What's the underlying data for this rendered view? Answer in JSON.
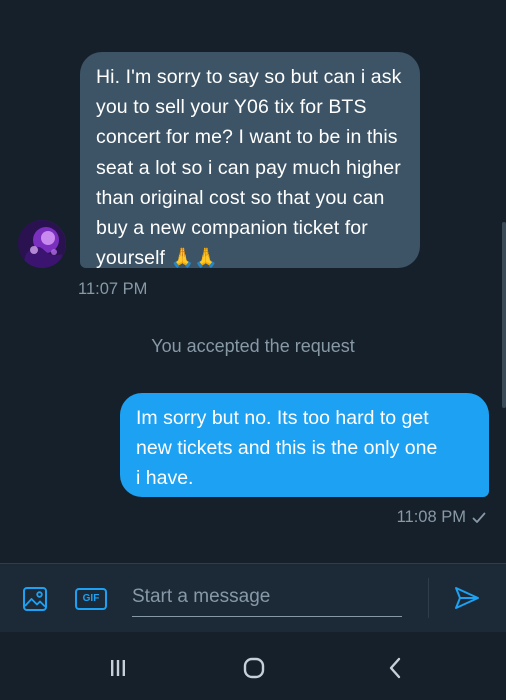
{
  "conversation": {
    "incoming_message": {
      "text": "Hi. I'm sorry to say so but can i ask\nyou to sell your Y06 tix for BTS\nconcert for me? I want to be in this\nseat  a lot so i can pay much higher\nthan original cost so that you can\nbuy a new companion ticket for\nyourself",
      "emoji": "🙏🙏",
      "time": "11:07 PM"
    },
    "system_note": "You accepted the request",
    "outgoing_message": {
      "text": "Im sorry but no. Its too hard to get\nnew tickets and this is the only one\ni have.",
      "time": "11:08 PM",
      "status_icon": "check-icon"
    }
  },
  "composer": {
    "media_icon": "image-icon",
    "gif_label": "GIF",
    "placeholder": "Start a message",
    "send_icon": "send-icon"
  },
  "navbar": {
    "buttons": [
      "recents-icon",
      "home-icon",
      "back-icon"
    ]
  },
  "colors": {
    "background": "#15202b",
    "incoming_bubble": "#3d5466",
    "outgoing_bubble": "#1da1f2",
    "accent": "#1da1f2",
    "muted_text": "#8899a6"
  }
}
